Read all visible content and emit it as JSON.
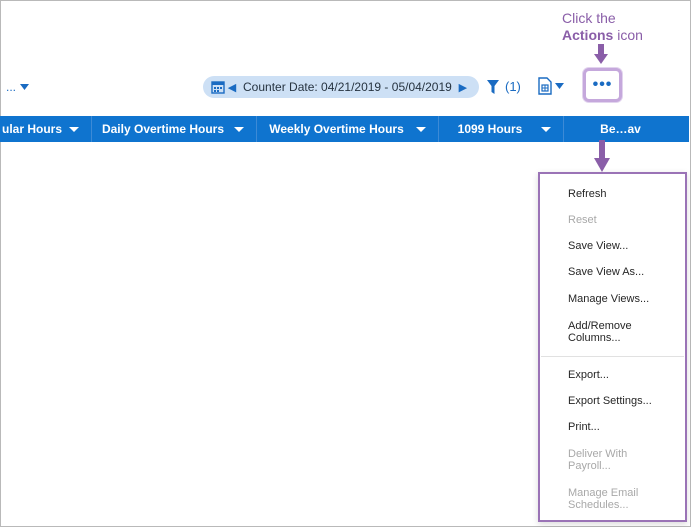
{
  "callout": {
    "line1": "Click the",
    "bold": "Actions",
    "line2_rest": " icon"
  },
  "toolbar": {
    "left_dropdown": "...",
    "date_range": "Counter Date: 04/21/2019 - 05/04/2019",
    "filter_count": "(1)"
  },
  "columns": [
    {
      "label": "ular Hours"
    },
    {
      "label": "Daily Overtime Hours"
    },
    {
      "label": "Weekly Overtime Hours"
    },
    {
      "label": "1099 Hours"
    },
    {
      "label": "Be…av"
    }
  ],
  "menu": {
    "items": [
      {
        "label": "Refresh",
        "enabled": true
      },
      {
        "label": "Reset",
        "enabled": false
      },
      {
        "label": "Save View...",
        "enabled": true
      },
      {
        "label": "Save View As...",
        "enabled": true
      },
      {
        "label": "Manage Views...",
        "enabled": true
      },
      {
        "label": "Add/Remove Columns...",
        "enabled": true
      },
      {
        "label": "Export...",
        "enabled": true
      },
      {
        "label": "Export Settings...",
        "enabled": true
      },
      {
        "label": "Print...",
        "enabled": true
      },
      {
        "label": "Deliver With Payroll...",
        "enabled": false
      },
      {
        "label": "Manage Email Schedules...",
        "enabled": false
      }
    ]
  },
  "colors": {
    "accent": "#0f74cf",
    "callout": "#8a5ea8",
    "highlight_border": "#c5a8dc"
  }
}
